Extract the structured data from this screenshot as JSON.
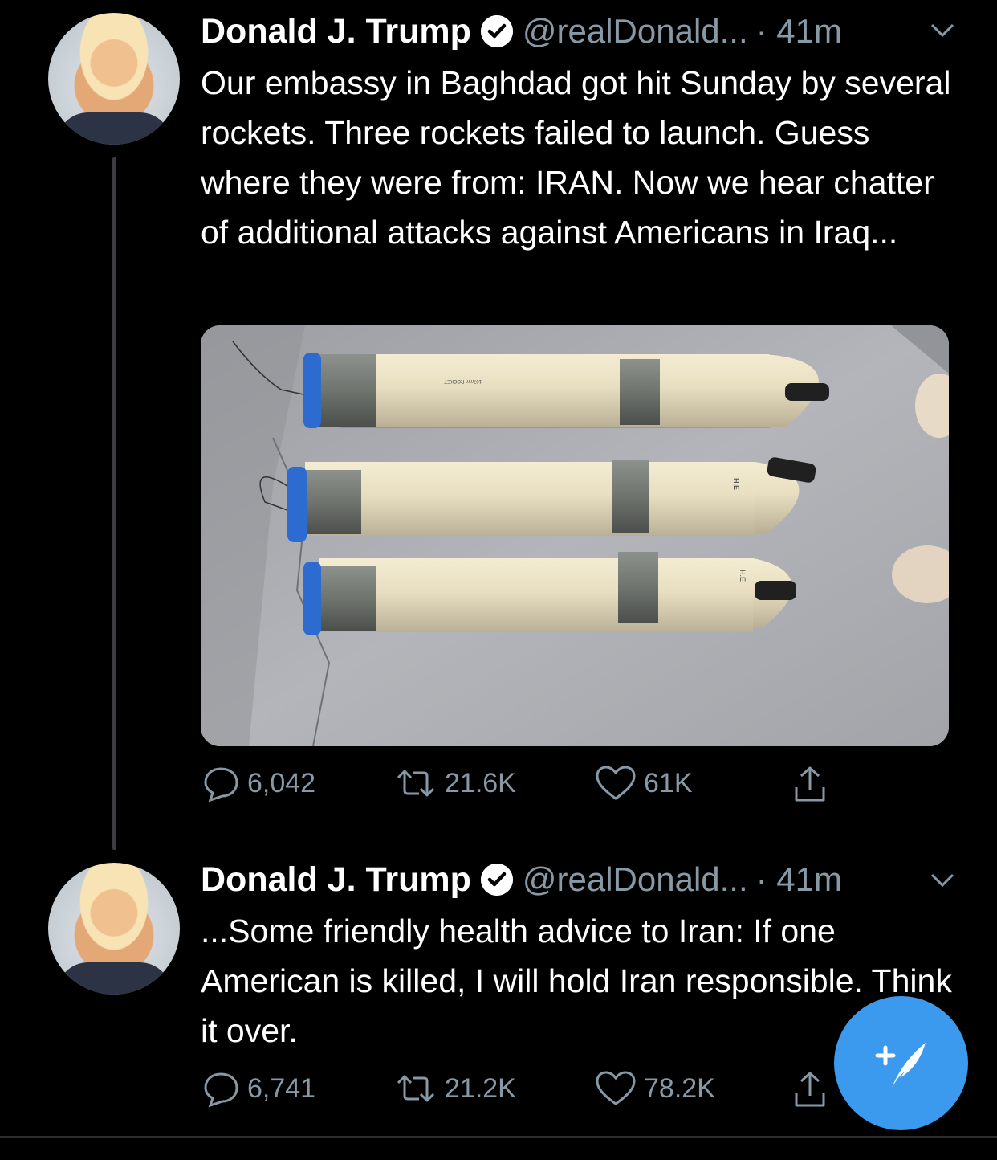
{
  "tweets": [
    {
      "name": "Donald J. Trump",
      "handle": "@realDonald...",
      "time": "· 41m",
      "text": "Our embassy in Baghdad got hit Sunday by several rockets. Three rockets failed to launch. Guess where they were from: IRAN. Now we hear chatter of additional attacks against Americans in Iraq...",
      "replies": "6,042",
      "retweets": "21.6K",
      "likes": "61K"
    },
    {
      "name": "Donald J. Trump",
      "handle": "@realDonald...",
      "time": "· 41m",
      "text": "...Some friendly health advice to Iran: If one American is killed, I will hold Iran responsible. Think it over.",
      "replies": "6,741",
      "retweets": "21.2K",
      "likes": "78.2K"
    }
  ],
  "media": {
    "rocket_labels": [
      "107mm ROCKET",
      "107mm ROCKET",
      "107mm ROCKET"
    ],
    "tip_labels": [
      "H.E",
      "H.E"
    ]
  },
  "colors": {
    "background": "#000000",
    "secondary_text": "#8899a6",
    "accent": "#3b9aed"
  },
  "icons": [
    "verified-badge-icon",
    "chevron-down-icon",
    "reply-icon",
    "retweet-icon",
    "like-icon",
    "share-icon",
    "compose-tweet-icon"
  ]
}
